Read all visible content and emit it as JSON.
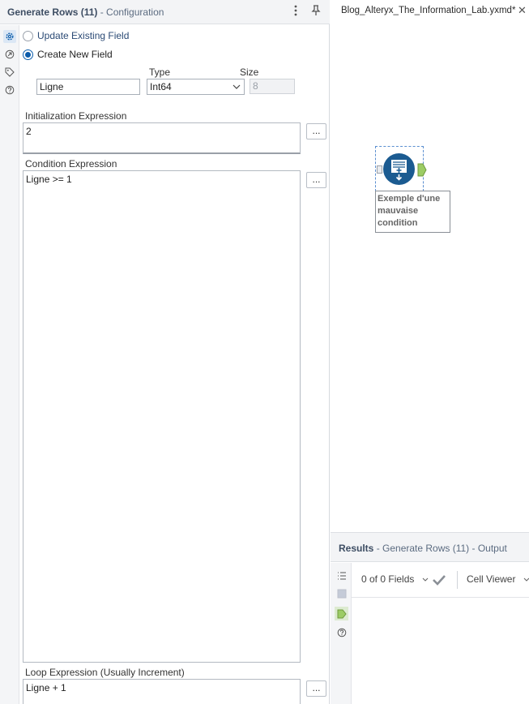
{
  "config": {
    "title": "Generate Rows (11)",
    "subtitle": " - Configuration",
    "mode_options": {
      "update_label": "Update Existing Field",
      "create_label": "Create New  Field",
      "selected": "create"
    },
    "columns": {
      "type_label": "Type",
      "size_label": "Size"
    },
    "field": {
      "name_value": "Ligne",
      "type_value": "Int64",
      "size_value": "8"
    },
    "init": {
      "label": "Initialization Expression",
      "value": "2"
    },
    "condition": {
      "label": "Condition Expression",
      "value": "Ligne >= 1"
    },
    "loop": {
      "label": "Loop Expression (Usually Increment)",
      "value": "Ligne + 1"
    },
    "dots_label": "..."
  },
  "canvas": {
    "tab_label": "Blog_Alteryx_The_Information_Lab.yxmd*",
    "close_glyph": "✕",
    "tool": {
      "caption": "Exemple d'une mauvaise condition",
      "icon": "generate-rows-icon"
    }
  },
  "results": {
    "title": "Results",
    "subtitle": " - Generate Rows (11) - Output",
    "fields_label": "0 of 0 Fields",
    "viewer_label": "Cell Viewer"
  },
  "colors": {
    "accent": "#0b5cab",
    "tool_blue": "#1b5b91",
    "anchor_green": "#9ccc65",
    "header_bg": "#f3f4f6"
  }
}
